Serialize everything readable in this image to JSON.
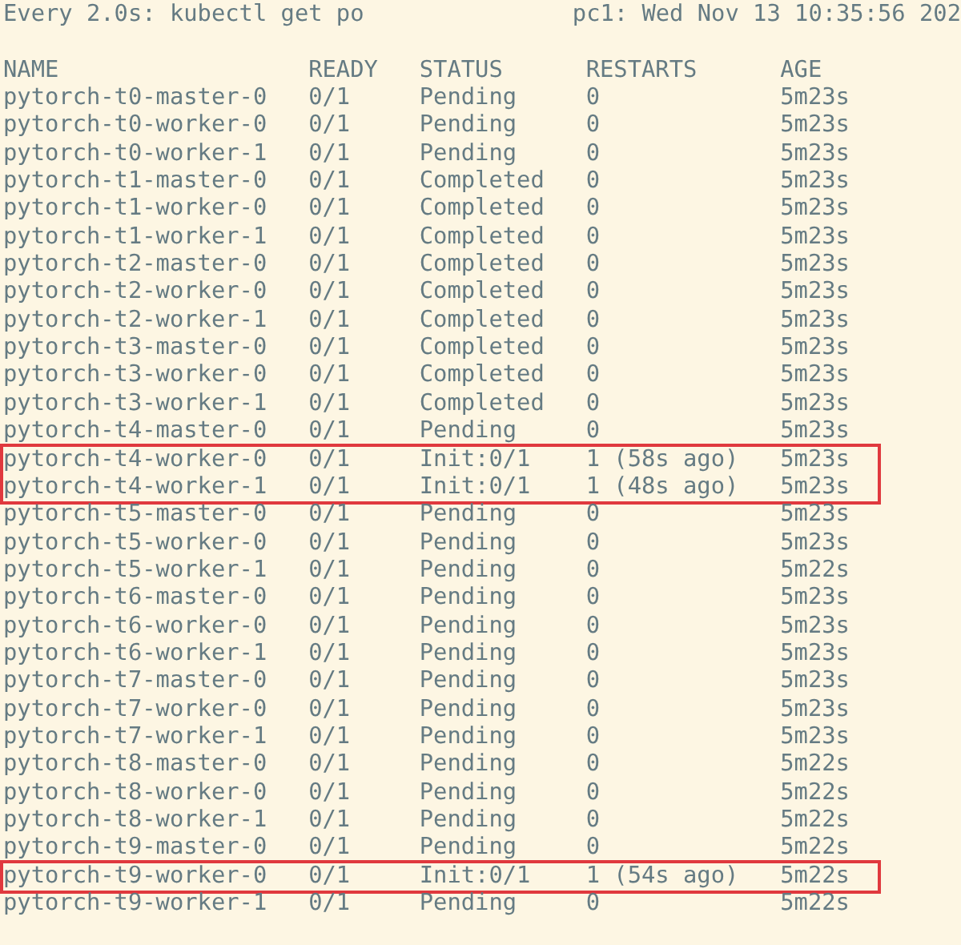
{
  "header": {
    "command": "Every 2.0s: kubectl get po",
    "host_time": "pc1: Wed Nov 13 10:35:56 202"
  },
  "columns": [
    "NAME",
    "READY",
    "STATUS",
    "RESTARTS",
    "AGE"
  ],
  "rows": [
    {
      "name": "pytorch-t0-master-0",
      "ready": "0/1",
      "status": "Pending",
      "restarts": "0",
      "age": "5m23s",
      "highlighted": false
    },
    {
      "name": "pytorch-t0-worker-0",
      "ready": "0/1",
      "status": "Pending",
      "restarts": "0",
      "age": "5m23s",
      "highlighted": false
    },
    {
      "name": "pytorch-t0-worker-1",
      "ready": "0/1",
      "status": "Pending",
      "restarts": "0",
      "age": "5m23s",
      "highlighted": false
    },
    {
      "name": "pytorch-t1-master-0",
      "ready": "0/1",
      "status": "Completed",
      "restarts": "0",
      "age": "5m23s",
      "highlighted": false
    },
    {
      "name": "pytorch-t1-worker-0",
      "ready": "0/1",
      "status": "Completed",
      "restarts": "0",
      "age": "5m23s",
      "highlighted": false
    },
    {
      "name": "pytorch-t1-worker-1",
      "ready": "0/1",
      "status": "Completed",
      "restarts": "0",
      "age": "5m23s",
      "highlighted": false
    },
    {
      "name": "pytorch-t2-master-0",
      "ready": "0/1",
      "status": "Completed",
      "restarts": "0",
      "age": "5m23s",
      "highlighted": false
    },
    {
      "name": "pytorch-t2-worker-0",
      "ready": "0/1",
      "status": "Completed",
      "restarts": "0",
      "age": "5m23s",
      "highlighted": false
    },
    {
      "name": "pytorch-t2-worker-1",
      "ready": "0/1",
      "status": "Completed",
      "restarts": "0",
      "age": "5m23s",
      "highlighted": false
    },
    {
      "name": "pytorch-t3-master-0",
      "ready": "0/1",
      "status": "Completed",
      "restarts": "0",
      "age": "5m23s",
      "highlighted": false
    },
    {
      "name": "pytorch-t3-worker-0",
      "ready": "0/1",
      "status": "Completed",
      "restarts": "0",
      "age": "5m23s",
      "highlighted": false
    },
    {
      "name": "pytorch-t3-worker-1",
      "ready": "0/1",
      "status": "Completed",
      "restarts": "0",
      "age": "5m23s",
      "highlighted": false
    },
    {
      "name": "pytorch-t4-master-0",
      "ready": "0/1",
      "status": "Pending",
      "restarts": "0",
      "age": "5m23s",
      "highlighted": false
    },
    {
      "name": "pytorch-t4-worker-0",
      "ready": "0/1",
      "status": "Init:0/1",
      "restarts": "1 (58s ago)",
      "age": "5m23s",
      "highlighted": true
    },
    {
      "name": "pytorch-t4-worker-1",
      "ready": "0/1",
      "status": "Init:0/1",
      "restarts": "1 (48s ago)",
      "age": "5m23s",
      "highlighted": true
    },
    {
      "name": "pytorch-t5-master-0",
      "ready": "0/1",
      "status": "Pending",
      "restarts": "0",
      "age": "5m23s",
      "highlighted": false
    },
    {
      "name": "pytorch-t5-worker-0",
      "ready": "0/1",
      "status": "Pending",
      "restarts": "0",
      "age": "5m23s",
      "highlighted": false
    },
    {
      "name": "pytorch-t5-worker-1",
      "ready": "0/1",
      "status": "Pending",
      "restarts": "0",
      "age": "5m22s",
      "highlighted": false
    },
    {
      "name": "pytorch-t6-master-0",
      "ready": "0/1",
      "status": "Pending",
      "restarts": "0",
      "age": "5m23s",
      "highlighted": false
    },
    {
      "name": "pytorch-t6-worker-0",
      "ready": "0/1",
      "status": "Pending",
      "restarts": "0",
      "age": "5m23s",
      "highlighted": false
    },
    {
      "name": "pytorch-t6-worker-1",
      "ready": "0/1",
      "status": "Pending",
      "restarts": "0",
      "age": "5m23s",
      "highlighted": false
    },
    {
      "name": "pytorch-t7-master-0",
      "ready": "0/1",
      "status": "Pending",
      "restarts": "0",
      "age": "5m23s",
      "highlighted": false
    },
    {
      "name": "pytorch-t7-worker-0",
      "ready": "0/1",
      "status": "Pending",
      "restarts": "0",
      "age": "5m23s",
      "highlighted": false
    },
    {
      "name": "pytorch-t7-worker-1",
      "ready": "0/1",
      "status": "Pending",
      "restarts": "0",
      "age": "5m23s",
      "highlighted": false
    },
    {
      "name": "pytorch-t8-master-0",
      "ready": "0/1",
      "status": "Pending",
      "restarts": "0",
      "age": "5m22s",
      "highlighted": false
    },
    {
      "name": "pytorch-t8-worker-0",
      "ready": "0/1",
      "status": "Pending",
      "restarts": "0",
      "age": "5m22s",
      "highlighted": false
    },
    {
      "name": "pytorch-t8-worker-1",
      "ready": "0/1",
      "status": "Pending",
      "restarts": "0",
      "age": "5m22s",
      "highlighted": false
    },
    {
      "name": "pytorch-t9-master-0",
      "ready": "0/1",
      "status": "Pending",
      "restarts": "0",
      "age": "5m22s",
      "highlighted": false
    },
    {
      "name": "pytorch-t9-worker-0",
      "ready": "0/1",
      "status": "Init:0/1",
      "restarts": "1 (54s ago)",
      "age": "5m22s",
      "highlighted": true
    },
    {
      "name": "pytorch-t9-worker-1",
      "ready": "0/1",
      "status": "Pending",
      "restarts": "0",
      "age": "5m22s",
      "highlighted": false
    }
  ]
}
